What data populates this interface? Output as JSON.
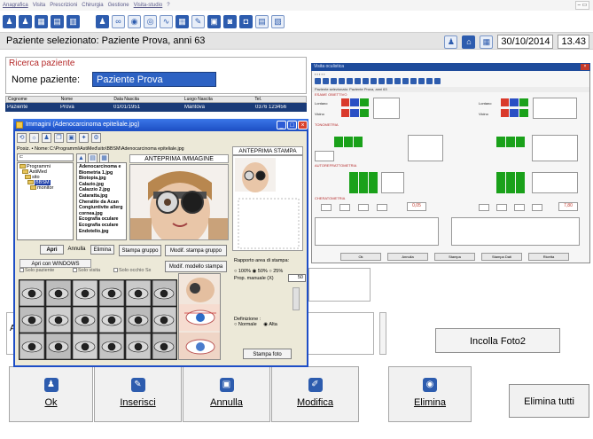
{
  "menu": [
    "Anagrafica",
    "Visita",
    "Prescrizioni",
    "Chirurgia",
    "Gestione",
    "Visita-studio",
    "?"
  ],
  "patient_header": {
    "text": "Paziente selezionato: Paziente Prova,  anni 63",
    "date": "30/10/2014",
    "time": "13.43"
  },
  "search": {
    "group_title": "Ricerca paziente",
    "name_label": "Nome paziente:",
    "name_value": "Paziente Prova",
    "grid_headers": [
      "Cognome",
      "Nome",
      "Data Nascita",
      "Luogo Nascita",
      "Tel."
    ],
    "grid_row": [
      "Paziente",
      "Prova",
      "01/01/1951",
      "Mantova",
      "0376 123456"
    ]
  },
  "right_window": {
    "title": "Visita oculistica",
    "patient_line": "Paziente selezionato: Paziente Prova, anni 63",
    "sections": [
      "ESAME OBIETTIVO",
      "TONOMETRIA",
      "AUTOREFRATTOMETRIA",
      "CHERATOMETRIA"
    ],
    "lontano": "Lontano",
    "vicino": "Vicino",
    "red_values": [
      "-1,25",
      "-1,00"
    ],
    "blue_values": [
      "2,25",
      "2,50"
    ],
    "value_a": "0,05",
    "value_b": "7,80",
    "buttons": [
      "Ok",
      "Annulla",
      "Stampa",
      "Stampa Dati",
      "Ricetta"
    ]
  },
  "dialog": {
    "title": "Immagini  (Adenocarcinoma epiteliale.jpg)",
    "path_label": "Posiz. • Nome:",
    "path_value": "C:\\Programmi\\AstiMed\\sito\\BBSM\\Adenocarcinoma epiteliale.jpg",
    "drive": "c:",
    "tree": [
      "Programmi",
      "AstiMed",
      "sito",
      "BBSM",
      "monitor"
    ],
    "files": [
      "Adenocarcinoma e",
      "Biometria 1.jpg",
      "Biotopia.jpg",
      "Calazio.jpg",
      "Calazzio 2.jpg",
      "Cataratta.jpg",
      "Cheratite da Acan",
      "Congiuntivite allerg",
      "cornea.jpg",
      "Ecografia oculare",
      "Ecografia oculare",
      "Endotelio.jpg"
    ],
    "preview_label": "ANTEPRIMA IMMAGINE",
    "print_label": "ANTEPRIMA STAMPA",
    "buttons": {
      "apri": "Apri",
      "annulla": "Annulla",
      "elimina": "Elimina",
      "stampa_gruppo": "Stampa gruppo",
      "modif_stampa": "Modif. stampa gruppo",
      "apri_win": "Apri con WINDOWS",
      "modif_modello": "Modif. modello stampa",
      "stampa_foto": "Stampa foto"
    },
    "checks": [
      "Solo paziente",
      "Solo visita",
      "Solo occhio Sx"
    ],
    "rapporto": "Rapporto area di stampa:",
    "rapporto_opts": [
      "100%",
      "50%",
      "25%"
    ],
    "prop_manual": "Prop. manuale (X)",
    "prop_value": "50",
    "definizione": "Definizione :",
    "def_opts": [
      "Normale",
      "Alta"
    ]
  },
  "incolla_label": "Incolla Foto2",
  "left_label_a": "Al",
  "bottom_buttons": [
    {
      "label": "Ok",
      "icon": "person-icon"
    },
    {
      "label": "Inserisci",
      "icon": "pencil-icon"
    },
    {
      "label": "Annulla",
      "icon": "cancel-icon"
    },
    {
      "label": "Modifica",
      "icon": "edit-icon"
    },
    {
      "label": "Elimina",
      "icon": "delete-icon"
    }
  ],
  "elimina_tutti": "Elimina tutti",
  "colors": {
    "accent": "#2d5cae",
    "title_red": "#b52a2a",
    "selection": "#1a3b78"
  }
}
